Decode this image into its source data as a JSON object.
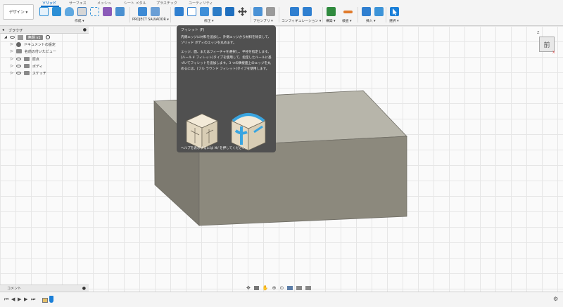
{
  "workspace": {
    "label": "デザイン ▾"
  },
  "tabs": [
    {
      "label": "ソリッド",
      "active": true
    },
    {
      "label": "サーフェス",
      "active": false
    },
    {
      "label": "メッシュ",
      "active": false
    },
    {
      "label": "シート メタル",
      "active": false
    },
    {
      "label": "プラスチック",
      "active": false
    },
    {
      "label": "ユーティリティ",
      "active": false
    }
  ],
  "groups": {
    "create": "作成 ▾",
    "automate": "PROJECT SALVADOR ▾",
    "modify": "修正 ▾",
    "assemble": "アセンブリ ▾",
    "configure": "コンフィギュレーション ▾",
    "construct": "構築 ▾",
    "inspect": "検査 ▾",
    "insert": "挿入 ▾",
    "select": "選択 ▾"
  },
  "browser": {
    "title": "ブラウザ",
    "root": "無題 v1",
    "items": [
      "ドキュメントの設定",
      "名前の付いたビュー",
      "原点",
      "ボディ",
      "スケッチ"
    ]
  },
  "tooltip": {
    "title": "フィレット (F)",
    "para1": "内側エッジに材料を追加し、外側エッジから材料を除去して、ソリッド ボディのエッジを丸めます。",
    "para2": "エッジ、面、またはフィーチャを選択し、半径を指定します。[ルールド フィレット]タイプを使用して、指定したルールに基づいてフィレットを追加します。3 つの隣接面上のエッジを丸めるには、[フル ラウンド フィレット]タイプを使用します。",
    "footer": "ヘルプを表示するには ⌘/ を押してください。"
  },
  "viewcube": {
    "face": "前",
    "axis_x": "X",
    "axis_z": "Z"
  },
  "comments": {
    "label": "コメント"
  },
  "colors": {
    "accent": "#0c6ec8",
    "body_front": "#8c897d",
    "body_top": "#b7b5aa"
  }
}
